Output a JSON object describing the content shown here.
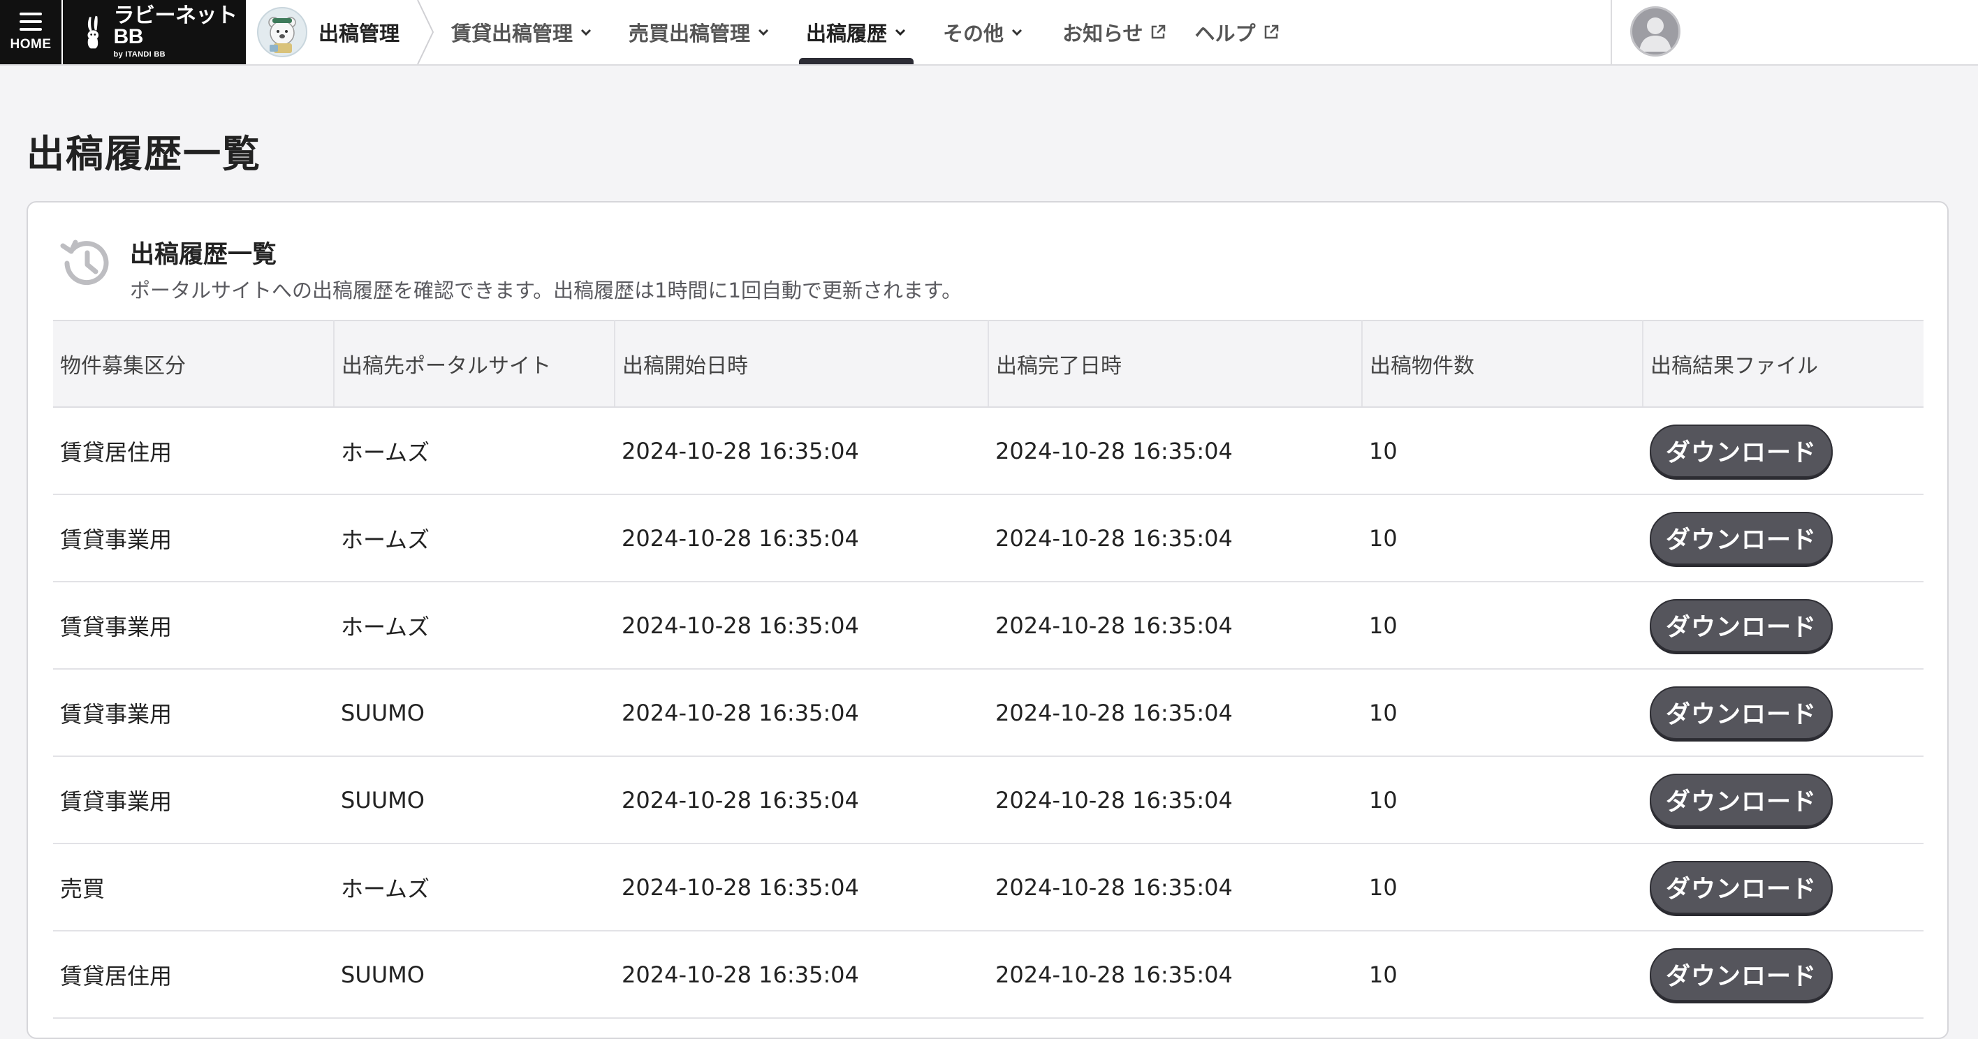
{
  "header": {
    "home_label": "HOME",
    "logo_main": "ラビーネットBB",
    "logo_sub": "by ITANDI BB",
    "app_title": "出稿管理",
    "nav": [
      {
        "label": "賃貸出稿管理",
        "icon": "chevron-down-icon",
        "active": false
      },
      {
        "label": "売買出稿管理",
        "icon": "chevron-down-icon",
        "active": false
      },
      {
        "label": "出稿履歴",
        "icon": "chevron-down-icon",
        "active": true
      },
      {
        "label": "その他",
        "icon": "chevron-down-icon",
        "active": false
      },
      {
        "label": "お知らせ",
        "icon": "external-link-icon",
        "active": false
      },
      {
        "label": "ヘルプ",
        "icon": "external-link-icon",
        "active": false
      }
    ]
  },
  "page": {
    "title": "出稿履歴一覧"
  },
  "card": {
    "title": "出稿履歴一覧",
    "description": "ポータルサイトへの出稿履歴を確認できます。出稿履歴は1時間に1回自動で更新されます。"
  },
  "table": {
    "columns": [
      "物件募集区分",
      "出稿先ポータルサイト",
      "出稿開始日時",
      "出稿完了日時",
      "出稿物件数",
      "出稿結果ファイル"
    ],
    "rows": [
      {
        "category": "賃貸居住用",
        "portal": "ホームズ",
        "start": "2024-10-28 16:35:04",
        "end": "2024-10-28 16:35:04",
        "count": "10",
        "action": "ダウンロード"
      },
      {
        "category": "賃貸事業用",
        "portal": "ホームズ",
        "start": "2024-10-28 16:35:04",
        "end": "2024-10-28 16:35:04",
        "count": "10",
        "action": "ダウンロード"
      },
      {
        "category": "賃貸事業用",
        "portal": "ホームズ",
        "start": "2024-10-28 16:35:04",
        "end": "2024-10-28 16:35:04",
        "count": "10",
        "action": "ダウンロード"
      },
      {
        "category": "賃貸事業用",
        "portal": "SUUMO",
        "start": "2024-10-28 16:35:04",
        "end": "2024-10-28 16:35:04",
        "count": "10",
        "action": "ダウンロード"
      },
      {
        "category": "賃貸事業用",
        "portal": "SUUMO",
        "start": "2024-10-28 16:35:04",
        "end": "2024-10-28 16:35:04",
        "count": "10",
        "action": "ダウンロード"
      },
      {
        "category": "売買",
        "portal": "ホームズ",
        "start": "2024-10-28 16:35:04",
        "end": "2024-10-28 16:35:04",
        "count": "10",
        "action": "ダウンロード"
      },
      {
        "category": "賃貸居住用",
        "portal": "SUUMO",
        "start": "2024-10-28 16:35:04",
        "end": "2024-10-28 16:35:04",
        "count": "10",
        "action": "ダウンロード"
      }
    ]
  },
  "colors": {
    "header_bg": "#ffffff",
    "home_bg": "#111111",
    "page_bg": "#f4f4f6",
    "button_bg": "#55555c",
    "active_underline": "#2c2c35"
  }
}
